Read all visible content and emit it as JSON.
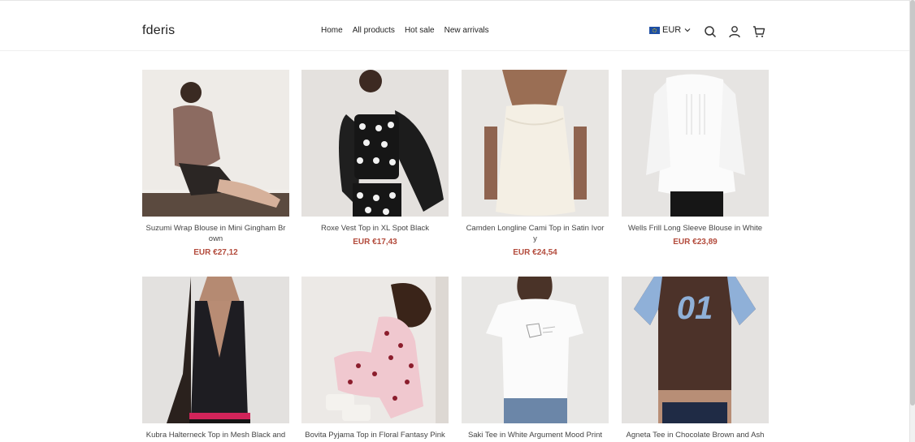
{
  "header": {
    "logo": "fderis",
    "nav": [
      "Home",
      "All products",
      "Hot sale",
      "New arrivals"
    ],
    "currency": "EUR"
  },
  "icons": [
    "search-icon",
    "account-icon",
    "cart-icon"
  ],
  "products": [
    {
      "title": "Suzumi Wrap Blouse in Mini Gingham Brown",
      "currency": "EUR",
      "price": "€27,12"
    },
    {
      "title": "Roxe Vest Top in XL Spot Black",
      "currency": "EUR",
      "price": "€17,43"
    },
    {
      "title": "Camden Longline Cami Top in Satin Ivory",
      "currency": "EUR",
      "price": "€24,54"
    },
    {
      "title": "Wells Frill Long Sleeve Blouse in White",
      "currency": "EUR",
      "price": "€23,89"
    },
    {
      "title": "Kubra Halterneck Top in Mesh Black and",
      "currency": "",
      "price": ""
    },
    {
      "title": "Bovita Pyjama Top in Floral Fantasy Pink",
      "currency": "",
      "price": ""
    },
    {
      "title": "Saki Tee in White Argument Mood Print",
      "currency": "",
      "price": ""
    },
    {
      "title": "Agneta Tee in Chocolate Brown and Ash",
      "currency": "",
      "price": ""
    }
  ]
}
